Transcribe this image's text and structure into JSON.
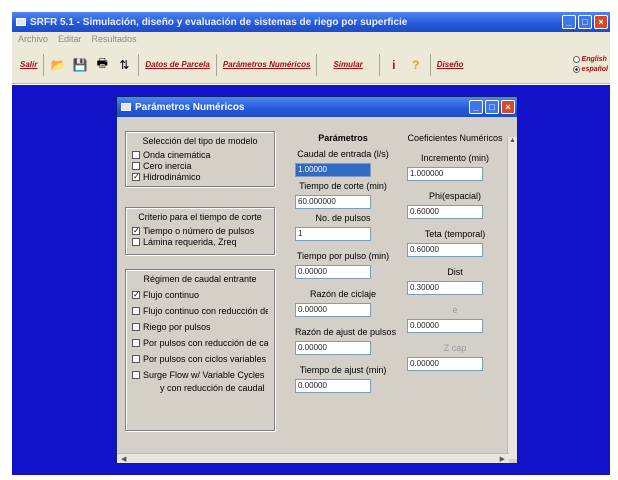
{
  "window": {
    "title": "SRFR 5.1 - Simulación, diseño y evaluación de sistemas de riego por superficie"
  },
  "menu": [
    "Archivo",
    "Editar",
    "Resultados"
  ],
  "toolbar": {
    "salir": "Salir",
    "datos_parcela": "Datos de Parcela",
    "parametros_numericos": "Parámetros Numéricos",
    "simular": "Simular",
    "diseño": "Diseño",
    "lang_english": "English",
    "lang_espanol": "español"
  },
  "dialog": {
    "title": "Parámetros Numéricos",
    "model_group": {
      "title": "Selección del tipo de modelo",
      "options": [
        {
          "label": "Onda cinemática",
          "checked": false
        },
        {
          "label": "Cero inercia",
          "checked": false
        },
        {
          "label": "Hidrodinámico",
          "checked": true
        }
      ]
    },
    "time_group": {
      "title": "Criterio para el tiempo de corte",
      "options": [
        {
          "label": "Tiempo o número de pulsos",
          "checked": true
        },
        {
          "label": "Lámina requerida, Zreq",
          "checked": false
        }
      ]
    },
    "flow_group": {
      "title": "Régimen de caudal entrante",
      "options": [
        {
          "label": "Flujo continuo",
          "checked": true
        },
        {
          "label": "Flujo continuo con reducción de...",
          "checked": false
        },
        {
          "label": "Riego por pulsos",
          "checked": false
        },
        {
          "label": "Por pulsos con reducción de ca...",
          "checked": false
        },
        {
          "label": "Por pulsos con ciclos variables",
          "checked": false
        },
        {
          "label": "Surge Flow w/ Variable Cycles",
          "checked": false
        }
      ],
      "extra": "y con reducción de caudal"
    },
    "params": {
      "title": "Parámetros",
      "fields": [
        {
          "label": "Caudal de entrada (l/s)",
          "value": "1.00000"
        },
        {
          "label": "Tiempo de corte (min)",
          "value": "60.000000"
        },
        {
          "label": "No. de pulsos",
          "value": "1"
        },
        {
          "label": "Tiempo por pulso (min)",
          "value": "0.00000"
        },
        {
          "label": "Razón de ciclaje",
          "value": "0.00000"
        },
        {
          "label": "Razón de ajust de pulsos",
          "value": "0.00000"
        },
        {
          "label": "Tiempo de ajust (min)",
          "value": "0.00000"
        }
      ]
    },
    "coeffs": {
      "title": "Coeficientes Numéricos",
      "fields": [
        {
          "label": "Incremento (min)",
          "value": "1.000000"
        },
        {
          "label": "Phi(espacial)",
          "value": "0.60000"
        },
        {
          "label": "Teta (temporal)",
          "value": "0.60000"
        },
        {
          "label": "Dist",
          "value": "0.30000"
        },
        {
          "label": "e",
          "value": "0.00000"
        },
        {
          "label": "Z cap",
          "value": "0.00000"
        }
      ]
    }
  }
}
